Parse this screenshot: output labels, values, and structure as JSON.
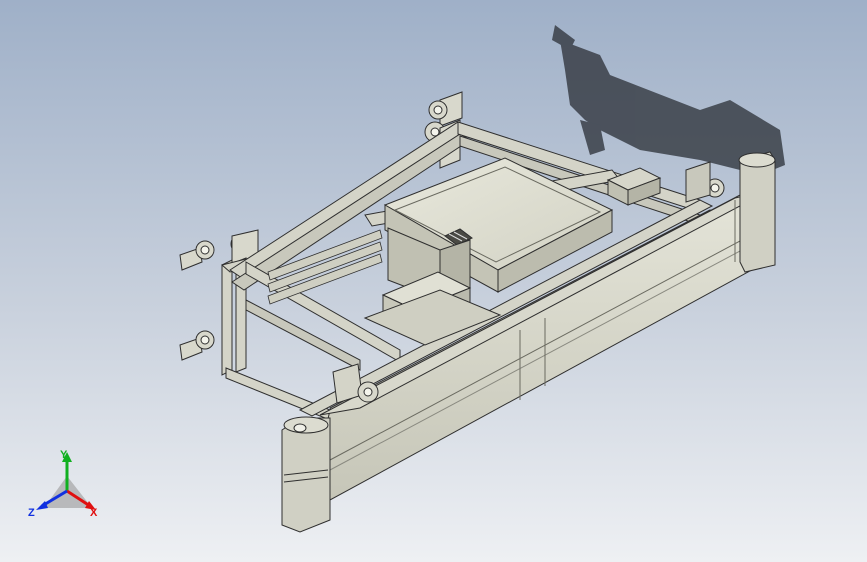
{
  "viewport": {
    "background_top": "#9fb0c8",
    "background_bottom": "#eef0f3",
    "model_color": "#dcdcd0",
    "edge_color": "#2f2f2f"
  },
  "triad": {
    "x_label": "X",
    "y_label": "Y",
    "z_label": "Z",
    "x_color": "#e01010",
    "y_color": "#10b020",
    "z_color": "#1030e0"
  }
}
